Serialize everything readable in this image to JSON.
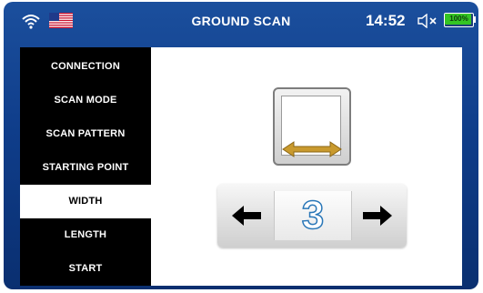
{
  "header": {
    "title": "GROUND SCAN",
    "time": "14:52",
    "battery_percent": "100%",
    "icons": {
      "wifi": "wifi-icon",
      "flag": "us-flag-icon",
      "sound": "speaker-muted-icon",
      "battery": "battery-icon"
    }
  },
  "sidebar": {
    "items": [
      {
        "label": "CONNECTION",
        "active": false
      },
      {
        "label": "SCAN MODE",
        "active": false
      },
      {
        "label": "SCAN PATTERN",
        "active": false
      },
      {
        "label": "STARTING POINT",
        "active": false
      },
      {
        "label": "WIDTH",
        "active": true
      },
      {
        "label": "LENGTH",
        "active": false
      },
      {
        "label": "START",
        "active": false
      }
    ]
  },
  "main": {
    "illustration": "width-icon",
    "stepper": {
      "value": "3",
      "decrement_icon": "arrow-left-icon",
      "increment_icon": "arrow-right-icon"
    }
  },
  "colors": {
    "screen_blue": "#0f3d8a",
    "battery_green": "#34c424",
    "arrow_gold": "#c99a2e",
    "value_outline": "#2a77b8"
  }
}
